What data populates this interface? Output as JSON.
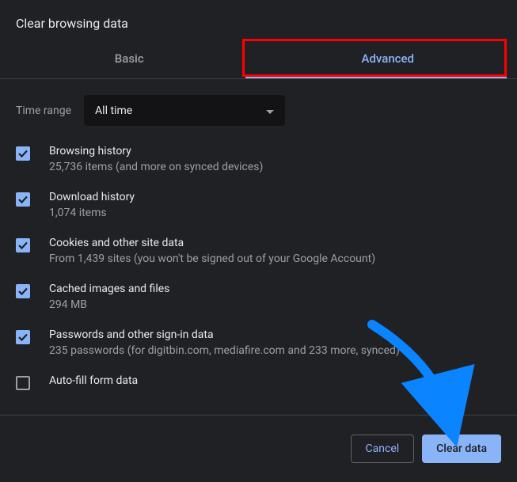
{
  "dialog": {
    "title": "Clear browsing data",
    "tabs": {
      "basic": "Basic",
      "advanced": "Advanced"
    },
    "timeRange": {
      "label": "Time range",
      "value": "All time"
    },
    "items": [
      {
        "title": "Browsing history",
        "sub": "25,736 items (and more on synced devices)",
        "checked": true
      },
      {
        "title": "Download history",
        "sub": "1,074 items",
        "checked": true
      },
      {
        "title": "Cookies and other site data",
        "sub": "From 1,439 sites (you won't be signed out of your Google Account)",
        "checked": true
      },
      {
        "title": "Cached images and files",
        "sub": "294 MB",
        "checked": true
      },
      {
        "title": "Passwords and other sign-in data",
        "sub": "235 passwords (for digitbin.com, mediafire.com and 233 more, synced)",
        "checked": true
      },
      {
        "title": "Auto-fill form data",
        "sub": "",
        "checked": false
      }
    ],
    "buttons": {
      "cancel": "Cancel",
      "clear": "Clear data"
    }
  }
}
